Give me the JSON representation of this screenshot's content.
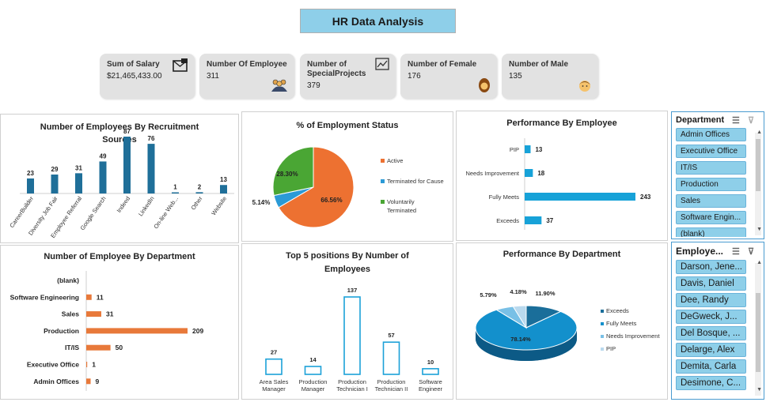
{
  "title": "HR Data Analysis",
  "kpis": [
    {
      "label": "Sum of Salary",
      "value": "$21,465,433.00",
      "icon": "money-envelope-icon"
    },
    {
      "label": "Number Of Employee",
      "value": "311",
      "icon": "people-icon"
    },
    {
      "label": "Number of SpecialProjects",
      "value": "379",
      "icon": "chart-icon"
    },
    {
      "label": "Number of Female",
      "value": "176",
      "icon": "female-icon"
    },
    {
      "label": "Number of Male",
      "value": "135",
      "icon": "male-icon"
    }
  ],
  "charts": {
    "recruitment": {
      "title": "Number of Employees By Recruitment Sources",
      "chart_data": {
        "type": "bar",
        "categories": [
          "CareerBuilder",
          "Diversity Job Fair",
          "Employee Referral",
          "Google Search",
          "Indeed",
          "LinkedIn",
          "On-line Web...",
          "Other",
          "Website"
        ],
        "values": [
          23,
          29,
          31,
          49,
          87,
          76,
          1,
          2,
          13
        ],
        "color": "#1f6f99"
      }
    },
    "employment_status": {
      "title": "% of Employment Status",
      "chart_data": {
        "type": "pie",
        "categories": [
          "Active",
          "Terminated for Cause",
          "Voluntarily Terminated"
        ],
        "values": [
          66.56,
          5.14,
          28.3
        ],
        "labels": [
          "66.56%",
          "5.14%",
          "28.30%"
        ],
        "colors": [
          "#ed7131",
          "#2b9ad6",
          "#4aa634"
        ],
        "legend": "right"
      }
    },
    "performance_employee": {
      "title": "Performance By Employee",
      "chart_data": {
        "type": "bar",
        "orientation": "horizontal",
        "categories": [
          "PIP",
          "Needs Improvement",
          "Fully Meets",
          "Exceeds"
        ],
        "values": [
          13,
          18,
          243,
          37
        ],
        "color": "#17a2d8"
      }
    },
    "by_department": {
      "title": "Number of Employee By Department",
      "chart_data": {
        "type": "bar",
        "orientation": "horizontal",
        "categories": [
          "(blank)",
          "Software Engineering",
          "Sales",
          "Production",
          "IT/IS",
          "Executive Office",
          "Admin Offices"
        ],
        "values": [
          null,
          11,
          31,
          209,
          50,
          1,
          9
        ],
        "color": "#e8793a"
      }
    },
    "top_positions": {
      "title": "Top 5 positions By Number of Employees",
      "chart_data": {
        "type": "bar",
        "categories": [
          "Area Sales Manager",
          "Production Manager",
          "Production Technician I",
          "Production Technician II",
          "Software Engineer"
        ],
        "values": [
          27,
          14,
          137,
          57,
          10
        ],
        "color": "#1ca1d8"
      }
    },
    "performance_department": {
      "title": "Performance By Department",
      "chart_data": {
        "type": "pie",
        "categories": [
          "Exceeds",
          "Fully Meets",
          "Needs Improvement",
          "PIP"
        ],
        "values": [
          11.9,
          78.14,
          5.79,
          4.18
        ],
        "labels": [
          "11.90%",
          "78.14%",
          "5.79%",
          "4.18%"
        ],
        "colors": [
          "#1a6e9a",
          "#1390cc",
          "#79c0e6",
          "#b9d9ee"
        ],
        "legend": "right"
      }
    }
  },
  "slicers": {
    "department": {
      "title": "Department",
      "items": [
        "Admin Offices",
        "Executive Office",
        "IT/IS",
        "Production",
        "Sales",
        "Software Engin...",
        "(blank)"
      ]
    },
    "employee": {
      "title": "Employe...",
      "items": [
        "Darson, Jene...",
        "Davis, Daniel",
        "Dee, Randy",
        "DeGweck, J...",
        "Del Bosque, ...",
        "Delarge, Alex",
        "Demita, Carla",
        "Desimone, C..."
      ]
    }
  }
}
